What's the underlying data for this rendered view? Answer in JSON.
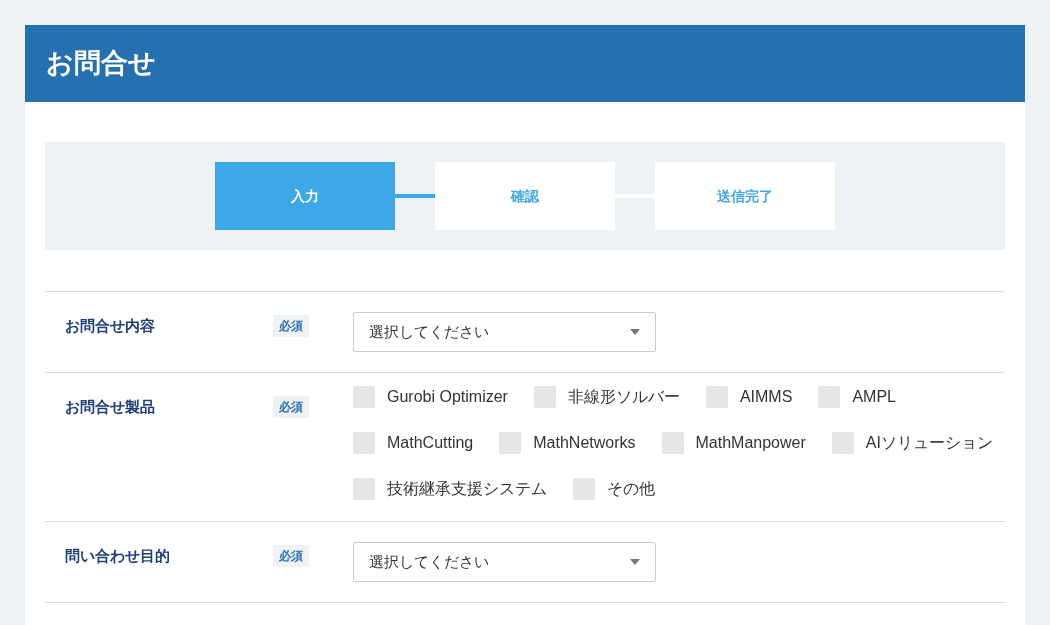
{
  "title": "お問合せ",
  "steps": [
    {
      "label": "入力",
      "selected": true
    },
    {
      "label": "確認",
      "selected": false
    },
    {
      "label": "送信完了",
      "selected": false
    }
  ],
  "fields": [
    {
      "kind": "select",
      "label": "お問合せ内容",
      "badge": "必須",
      "placeholder": "選択してください"
    },
    {
      "kind": "checkboxes",
      "label": "お問合せ製品",
      "badge": "必須",
      "options": [
        {
          "label": "Gurobi Optimizer",
          "checked": false
        },
        {
          "label": "非線形ソルバー",
          "checked": false
        },
        {
          "label": "AIMMS",
          "checked": false
        },
        {
          "label": "AMPL",
          "checked": false
        },
        {
          "label": "MathCutting",
          "checked": false
        },
        {
          "label": "MathNetworks",
          "checked": false
        },
        {
          "label": "MathManpower",
          "checked": false
        },
        {
          "label": "AIソリューション",
          "checked": false
        },
        {
          "label": "技術継承支援システム",
          "checked": false
        },
        {
          "label": "その他",
          "checked": false
        }
      ]
    },
    {
      "kind": "select",
      "label": "問い合わせ目的",
      "badge": "必須",
      "placeholder": "選択してください"
    }
  ]
}
